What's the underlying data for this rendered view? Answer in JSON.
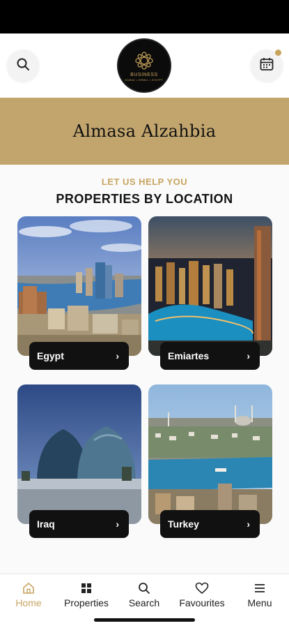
{
  "header": {
    "logo": {
      "title": "BUSINESS",
      "subtitle": "DUBAI • ERBIL • EGYPT"
    },
    "search_icon": "search-icon",
    "calendar_icon": "calendar-icon"
  },
  "banner": {
    "title": "Almasa Alzahbia"
  },
  "section": {
    "eyebrow": "LET US HELP YOU",
    "title": "PROPERTIES BY LOCATION"
  },
  "locations": [
    {
      "label": "Egypt"
    },
    {
      "label": "Emiartes"
    },
    {
      "label": "Iraq"
    },
    {
      "label": "Turkey"
    }
  ],
  "nav": {
    "items": [
      {
        "label": "Home",
        "icon": "home-icon",
        "active": true
      },
      {
        "label": "Properties",
        "icon": "grid-icon",
        "active": false
      },
      {
        "label": "Search",
        "icon": "search-icon",
        "active": false
      },
      {
        "label": "Favourites",
        "icon": "heart-icon",
        "active": false
      },
      {
        "label": "Menu",
        "icon": "menu-icon",
        "active": false
      }
    ]
  },
  "colors": {
    "accent": "#c8a561",
    "banner": "#c2a56d",
    "dark": "#111111"
  }
}
